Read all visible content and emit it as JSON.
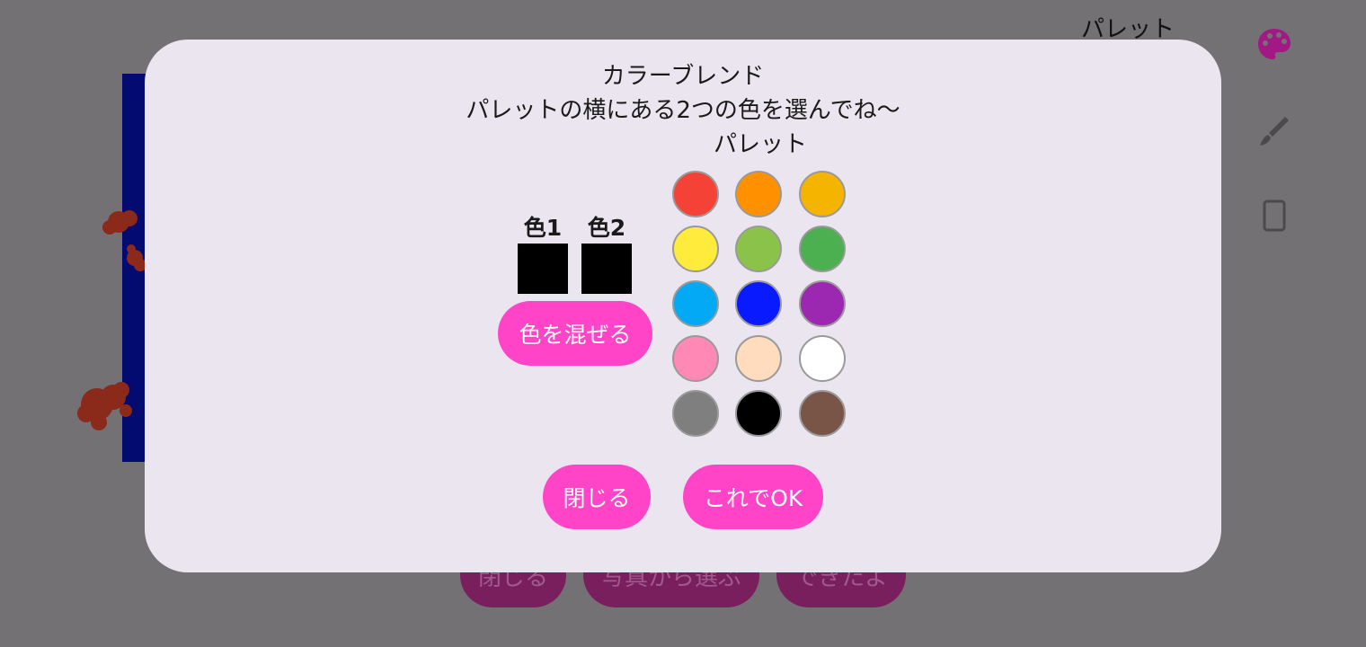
{
  "background": {
    "title": "パレット",
    "buttons": [
      {
        "label": "閉じる"
      },
      {
        "label": "写真から選ぶ"
      },
      {
        "label": "できたよ"
      }
    ]
  },
  "dialog": {
    "title": "カラーブレンド",
    "instruction": "パレットの横にある2つの色を選んでね〜",
    "palette_label": "パレット",
    "slots": [
      {
        "label": "色1",
        "color": "#000000"
      },
      {
        "label": "色2",
        "color": "#000000"
      }
    ],
    "mix_button": "色を混ぜる",
    "close_button": "閉じる",
    "ok_button": "これでOK",
    "palette": [
      "#f44336",
      "#ff9100",
      "#f5b400",
      "#ffeb3b",
      "#8bc34a",
      "#4caf50",
      "#03a9f4",
      "#0a1aff",
      "#9c27b0",
      "#ff88b4",
      "#ffdcbe",
      "#ffffff",
      "#7f7f7f",
      "#000000",
      "#795548"
    ]
  },
  "colors": {
    "accent": "#ff44c8",
    "dialog_bg": "#ebe5ef",
    "overlay": "#737174"
  }
}
